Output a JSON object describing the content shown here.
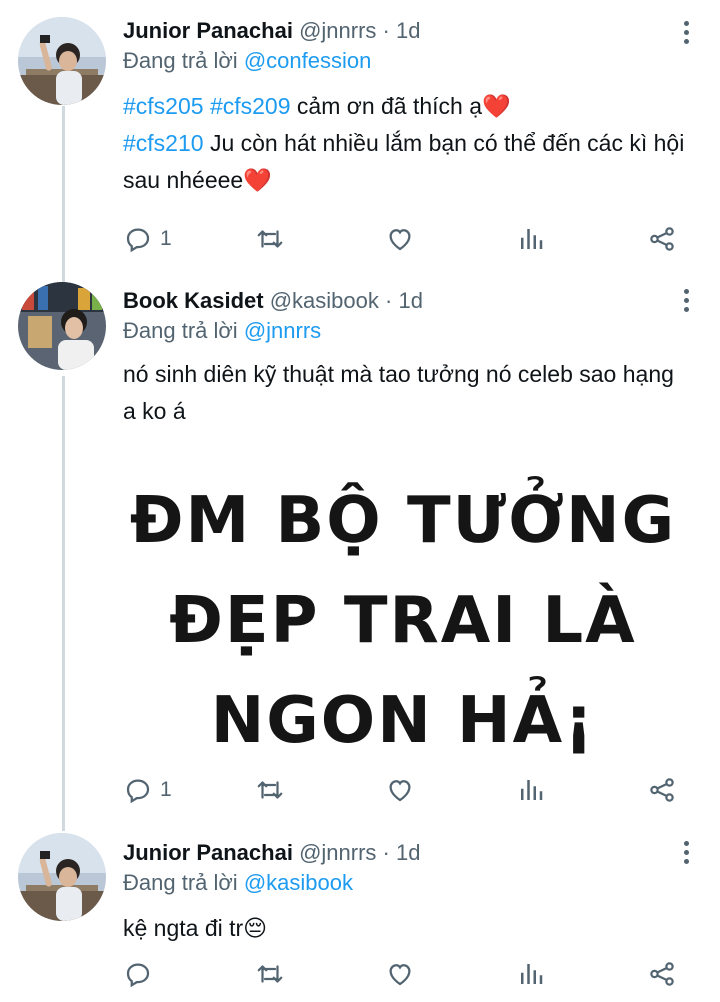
{
  "tweets": [
    {
      "name": "Junior Panachai",
      "handle": "@jnnrrs",
      "dot": "·",
      "time": "1d",
      "replying_prefix": "Đang trả lời",
      "replying_to": "@confession",
      "line1_tag1": "#cfs205",
      "line1_tag2": "#cfs209",
      "line1_text": " cảm ơn đã thích ạ❤️",
      "line2_tag": "#cfs210",
      "line2_text": " Ju còn hát nhiều lắm bạn có thể đến các kì hội sau nhéeee❤️",
      "reply_count": "1",
      "retweet_count": "",
      "like_count": ""
    },
    {
      "name": "Book Kasidet",
      "handle": "@kasibook",
      "dot": "·",
      "time": "1d",
      "replying_prefix": "Đang trả lời",
      "replying_to": "@jnnrrs",
      "text": "nó sinh diên kỹ thuật mà tao tưởng nó celeb sao hạng a ko á",
      "meme_lines": [
        "ĐM BỘ TƯỞNG",
        "ĐẸP TRAI LÀ",
        "NGON HẢ¡"
      ],
      "reply_count": "1",
      "retweet_count": "",
      "like_count": ""
    },
    {
      "name": "Junior Panachai",
      "handle": "@jnnrrs",
      "dot": "·",
      "time": "1d",
      "replying_prefix": "Đang trả lời",
      "replying_to": "@kasibook",
      "text": "kệ ngta đi tr😔",
      "reply_count": "",
      "retweet_count": "",
      "like_count": ""
    }
  ],
  "icons": {
    "reply": "reply-icon",
    "retweet": "retweet-icon",
    "like": "heart-icon",
    "views": "views-icon",
    "share": "share-icon",
    "more": "more-vertical-icon"
  },
  "colors": {
    "link": "#1d9bf0",
    "secondary": "#536471",
    "thread_line": "#cfd9de"
  }
}
